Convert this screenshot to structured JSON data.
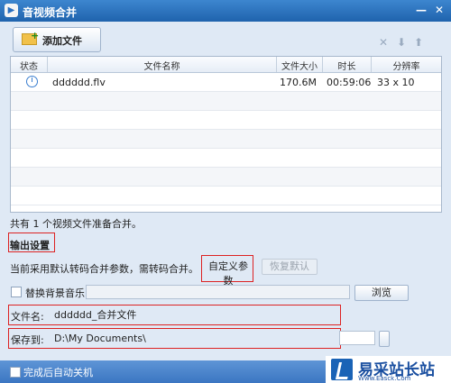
{
  "window": {
    "title": "音视频合并"
  },
  "toolbar": {
    "add_file_label": "添加文件"
  },
  "table": {
    "headers": [
      "状态",
      "文件名称",
      "文件大小",
      "时长",
      "分辨率"
    ],
    "rows": [
      {
        "name": "dddddd.flv",
        "size": "170.6M",
        "duration": "00:59:06",
        "resolution": "33 x 10"
      }
    ]
  },
  "status_text": "共有 1 个视频文件准备合并。",
  "output": {
    "section_title": "输出设置",
    "description": "当前采用默认转码合并参数，需转码合并。",
    "custom_params_label": "自定义参数",
    "restore_default_label": "恢复默认",
    "replace_music_label": "替换背景音乐",
    "browse_label": "浏览",
    "filename_label": "文件名:",
    "filename_value": "dddddd_合并文件",
    "save_to_label": "保存到:",
    "save_to_value": "D:\\My Documents\\"
  },
  "footer": {
    "shutdown_label": "完成后自动关机"
  },
  "watermark": {
    "text": "易采站长站",
    "url": "Www.Easck.Com"
  },
  "colors": {
    "title_bar": "#2a71bf",
    "window_bg": "#dfe9f5",
    "highlight_red": "#dd2222"
  }
}
